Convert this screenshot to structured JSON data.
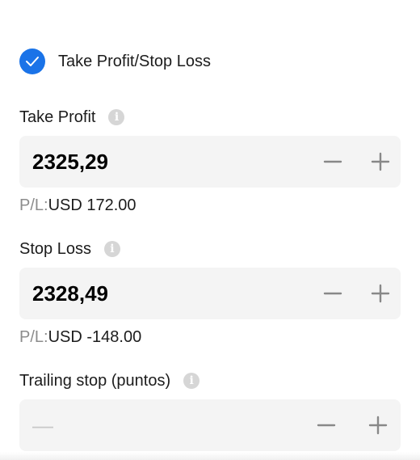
{
  "tpsl": {
    "checked": true,
    "label": "Take Profit/Stop Loss",
    "accent_color": "#1a73e8"
  },
  "take_profit": {
    "title": "Take Profit",
    "value": "2325,29",
    "pl_label": "P/L:",
    "pl_value": "USD 172.00"
  },
  "stop_loss": {
    "title": "Stop Loss",
    "value": "2328,49",
    "pl_label": "P/L:",
    "pl_value": "USD -148.00"
  },
  "trailing_stop": {
    "title": "Trailing stop (puntos)",
    "value": "—"
  },
  "icons": {
    "info": "info-icon",
    "check": "check-icon",
    "minus": "minus-icon",
    "plus": "plus-icon"
  }
}
